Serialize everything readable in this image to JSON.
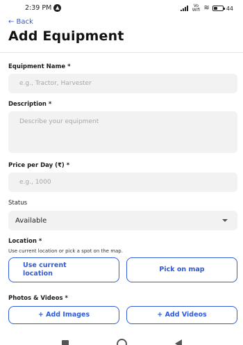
{
  "status_bar": {
    "time": "2:39 PM",
    "time_badge": "▲",
    "network_label": "Vo Wifi",
    "battery_level": 0.44,
    "battery_text": "44"
  },
  "header": {
    "back_label": "← Back",
    "title": "Add Equipment"
  },
  "form": {
    "equipment_name": {
      "label": "Equipment Name *",
      "placeholder": "e.g., Tractor, Harvester",
      "value": ""
    },
    "description": {
      "label": "Description *",
      "placeholder": "Describe your equipment",
      "value": ""
    },
    "price": {
      "label": "Price per Day (₹) *",
      "placeholder": "e.g., 1000",
      "value": ""
    },
    "status": {
      "label": "Status",
      "selected": "Available"
    },
    "location": {
      "label": "Location *",
      "helper": "Use current location or pick a spot on the map.",
      "use_current_label": "Use current location",
      "pick_on_map_label": "Pick on map"
    },
    "media": {
      "label": "Photos & Videos *",
      "add_images_label": "+ Add Images",
      "add_videos_label": "+ Add Videos"
    }
  },
  "colors": {
    "accent": "#2f5bd9",
    "input_bg": "#f2f2f2",
    "placeholder": "#a6a6a6"
  }
}
